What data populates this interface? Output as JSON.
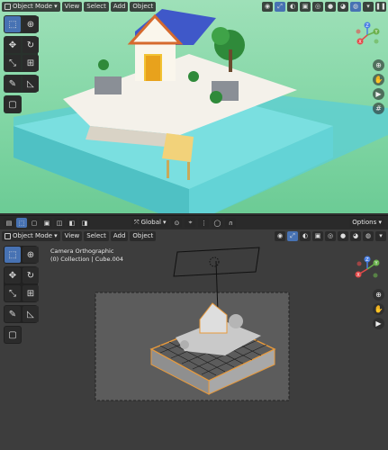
{
  "top_viewport": {
    "mode": "Object Mode",
    "menus": [
      "View",
      "Select",
      "Add",
      "Object"
    ]
  },
  "middle_header": {
    "orientation": "Global",
    "options": "Options"
  },
  "bottom_viewport": {
    "mode": "Object Mode",
    "menus": [
      "View",
      "Select",
      "Add",
      "Object"
    ],
    "camera_title": "Camera Orthographic",
    "collection_info": "(0) Collection | Cube.004"
  },
  "gizmo_axes": [
    "Z",
    "Y",
    "X"
  ],
  "colors": {
    "accent": "#4772b3",
    "x_axis": "#e34a4a",
    "y_axis": "#6ab04c",
    "z_axis": "#4a7fe3",
    "selection_orange": "#e89a3c"
  }
}
